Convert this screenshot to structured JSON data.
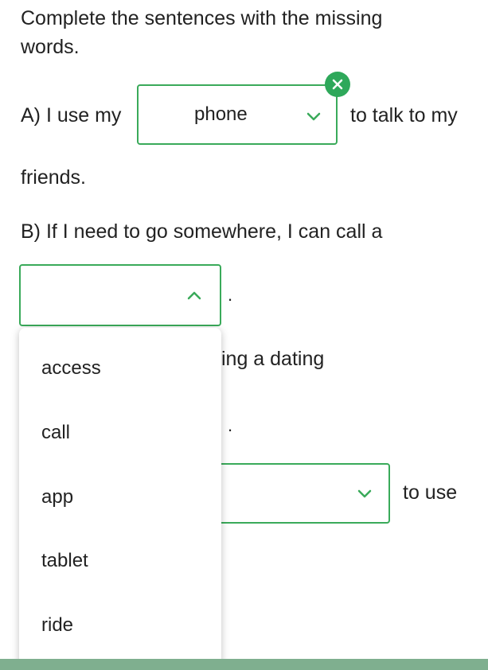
{
  "instructions": {
    "line1": "Complete the sentences with the missing",
    "line2": "words."
  },
  "sentence_a": {
    "prefix": "A) I use my",
    "selected": "phone",
    "suffix": "to talk to my",
    "line2": "friends."
  },
  "sentence_b": {
    "line1": "B) If I need to go somewhere, I can call a",
    "selected": "",
    "end": "."
  },
  "sentence_c": {
    "partial": "ing a dating",
    "end": ".",
    "suffix": "to use"
  },
  "dropdown_options": [
    "access",
    "call",
    "app",
    "tablet",
    "ride"
  ],
  "colors": {
    "accent": "#3aaa5a",
    "badge": "#2ea85a",
    "bottom_bar": "#7faf8f"
  },
  "icons": {
    "clear": "close-icon",
    "chevron_down": "chevron-down-icon",
    "chevron_up": "chevron-up-icon"
  }
}
